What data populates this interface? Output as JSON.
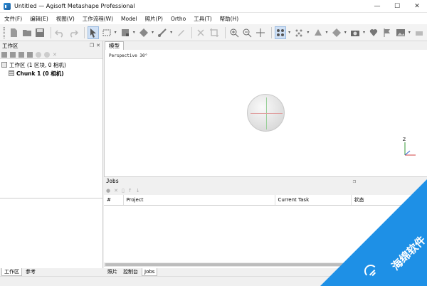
{
  "window": {
    "title": "Untitled — Agisoft Metashape Professional",
    "minimize": "—",
    "maximize": "☐",
    "close": "✕"
  },
  "menu": [
    "文件(F)",
    "编辑(E)",
    "视图(V)",
    "工作流程(W)",
    "Model",
    "照片(P)",
    "Ortho",
    "工具(T)",
    "帮助(H)"
  ],
  "workspace": {
    "header": "工作区",
    "root_label": "工作区 (1 区块, 0 相机)",
    "chunk_label": "Chunk 1 (0 相机)"
  },
  "viewport": {
    "tab": "模型",
    "mode_label": "Perspective 30°",
    "axis_z": "Z"
  },
  "jobs": {
    "header": "Jobs",
    "columns": [
      "#",
      "Project",
      "Current Task",
      "状态"
    ]
  },
  "bottom_tabs_left": [
    "工作区",
    "参考"
  ],
  "bottom_tabs_right": [
    "照片",
    "控制台",
    "Jobs"
  ],
  "watermark": {
    "text": "海绵软件"
  },
  "colors": {
    "accent": "#1e90e6",
    "active_tab": "#cfe0f5"
  }
}
